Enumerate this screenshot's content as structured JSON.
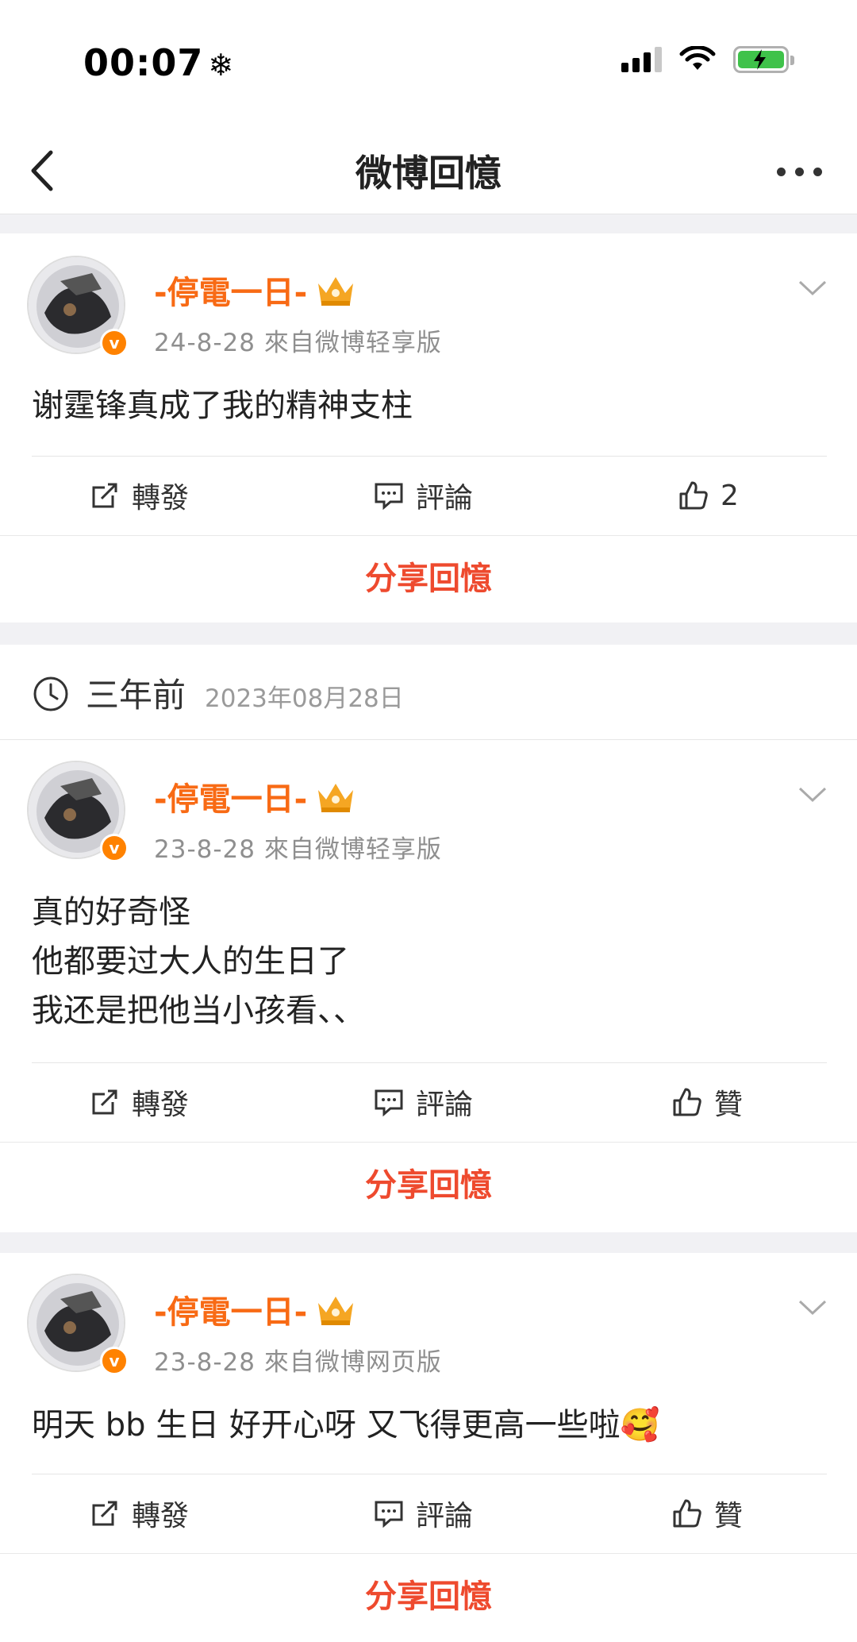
{
  "status_bar": {
    "time": "00:07",
    "snow_icon": "❄"
  },
  "nav": {
    "title": "微博回憶"
  },
  "memory_header": {
    "ago": "三年前",
    "date": "2023年08月28日"
  },
  "posts": [
    {
      "username": "-停電一日-",
      "meta": "24-8-28  來自微博轻享版",
      "content": "谢霆锋真成了我的精神支柱",
      "repost": "轉發",
      "comment": "評論",
      "like": "2",
      "share": "分享回憶"
    },
    {
      "username": "-停電一日-",
      "meta": "23-8-28  來自微博轻享版",
      "content": "真的好奇怪\n他都要过大人的生日了\n我还是把他当小孩看、、",
      "repost": "轉發",
      "comment": "評論",
      "like": "贊",
      "share": "分享回憶"
    },
    {
      "username": "-停電一日-",
      "meta": "23-8-28  來自微博网页版",
      "content": "明天 bb 生日 好开心呀 又飞得更高一些啦🥰",
      "repost": "轉發",
      "comment": "評論",
      "like": "贊",
      "share": "分享回憶"
    }
  ],
  "colors": {
    "username": "#f86a14",
    "share": "#ee4a2e",
    "verified": "#ff8200",
    "divider": "#f1f1f4"
  }
}
